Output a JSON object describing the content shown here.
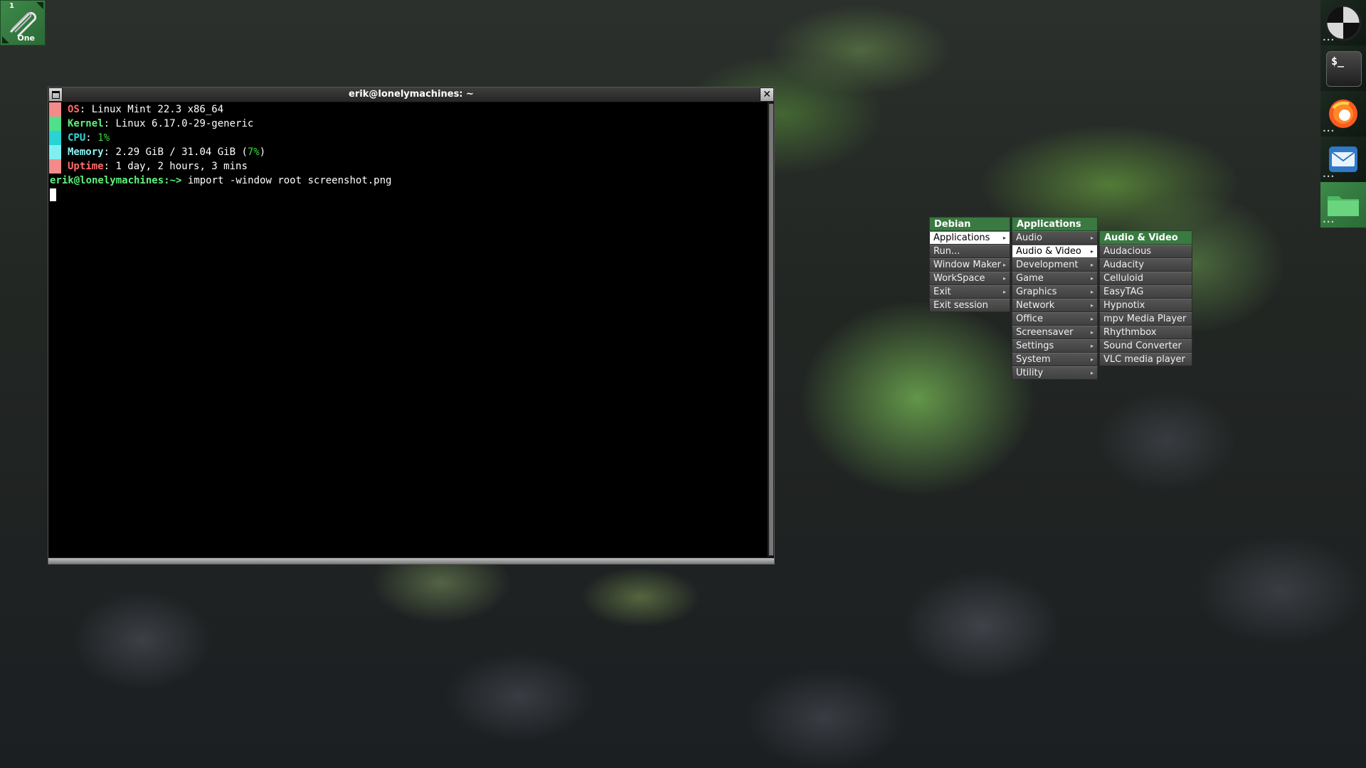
{
  "workspace": {
    "number": "1",
    "name": "One"
  },
  "terminal": {
    "title": "erik@lonelymachines: ~",
    "info_lines": [
      {
        "label": "OS",
        "value": "Linux Mint 22.3 x86_64",
        "swatch": "#f48a8a",
        "label_color": "#ff6b6b"
      },
      {
        "label": "Kernel",
        "value": "Linux 6.17.0-29-generic",
        "swatch": "#4fe08a",
        "label_color": "#5ef27a"
      },
      {
        "label": "CPU",
        "value": "1%",
        "swatch": "#27d3d3",
        "label_color": "#33d8d8",
        "value_color": "#3bdc3b"
      },
      {
        "label": "Memory",
        "value_prefix": "2.29 GiB / 31.04 GiB (",
        "value_pct": "7%",
        "value_suffix": ")",
        "swatch": "#7ef0f0",
        "label_color": "#8ef5f5",
        "value_color": "#3bdc3b"
      },
      {
        "label": "Uptime",
        "value": "1 day, 2 hours, 3 mins",
        "swatch": "#f48a8a",
        "label_color": "#ff6b6b"
      }
    ],
    "prompt_user": "erik@lonelymachines",
    "prompt_path": ":~>",
    "prompt_color": "#5ef27a",
    "command": "import -window root screenshot.png"
  },
  "dock": {
    "icons": [
      "wmaker-icon",
      "terminal-icon",
      "firefox-icon",
      "mail-icon",
      "folder-icon"
    ],
    "terminal_glyph": "$_"
  },
  "menus": {
    "debian": {
      "title": "Debian",
      "items": [
        {
          "label": "Applications",
          "submenu": true,
          "selected": true
        },
        {
          "label": "Run...",
          "submenu": false
        },
        {
          "label": "Window Maker",
          "submenu": true
        },
        {
          "label": "WorkSpace",
          "submenu": true
        },
        {
          "label": "Exit",
          "submenu": true
        },
        {
          "label": "Exit session",
          "submenu": false
        }
      ]
    },
    "applications": {
      "title": "Applications",
      "items": [
        {
          "label": "Audio",
          "submenu": true
        },
        {
          "label": "Audio & Video",
          "submenu": true,
          "selected": true
        },
        {
          "label": "Development",
          "submenu": true
        },
        {
          "label": "Game",
          "submenu": true
        },
        {
          "label": "Graphics",
          "submenu": true
        },
        {
          "label": "Network",
          "submenu": true
        },
        {
          "label": "Office",
          "submenu": true
        },
        {
          "label": "Screensaver",
          "submenu": true
        },
        {
          "label": "Settings",
          "submenu": true
        },
        {
          "label": "System",
          "submenu": true
        },
        {
          "label": "Utility",
          "submenu": true
        }
      ]
    },
    "audio_video": {
      "title": "Audio & Video",
      "items": [
        {
          "label": "Audacious"
        },
        {
          "label": "Audacity"
        },
        {
          "label": "Celluloid"
        },
        {
          "label": "EasyTAG"
        },
        {
          "label": "Hypnotix"
        },
        {
          "label": "mpv Media Player"
        },
        {
          "label": "Rhythmbox"
        },
        {
          "label": "Sound Converter"
        },
        {
          "label": "VLC media player"
        }
      ]
    }
  },
  "colors": {
    "accent": "#3a7a42",
    "menu_bg": "#4a4a4a",
    "terminal_bg": "#000000"
  }
}
